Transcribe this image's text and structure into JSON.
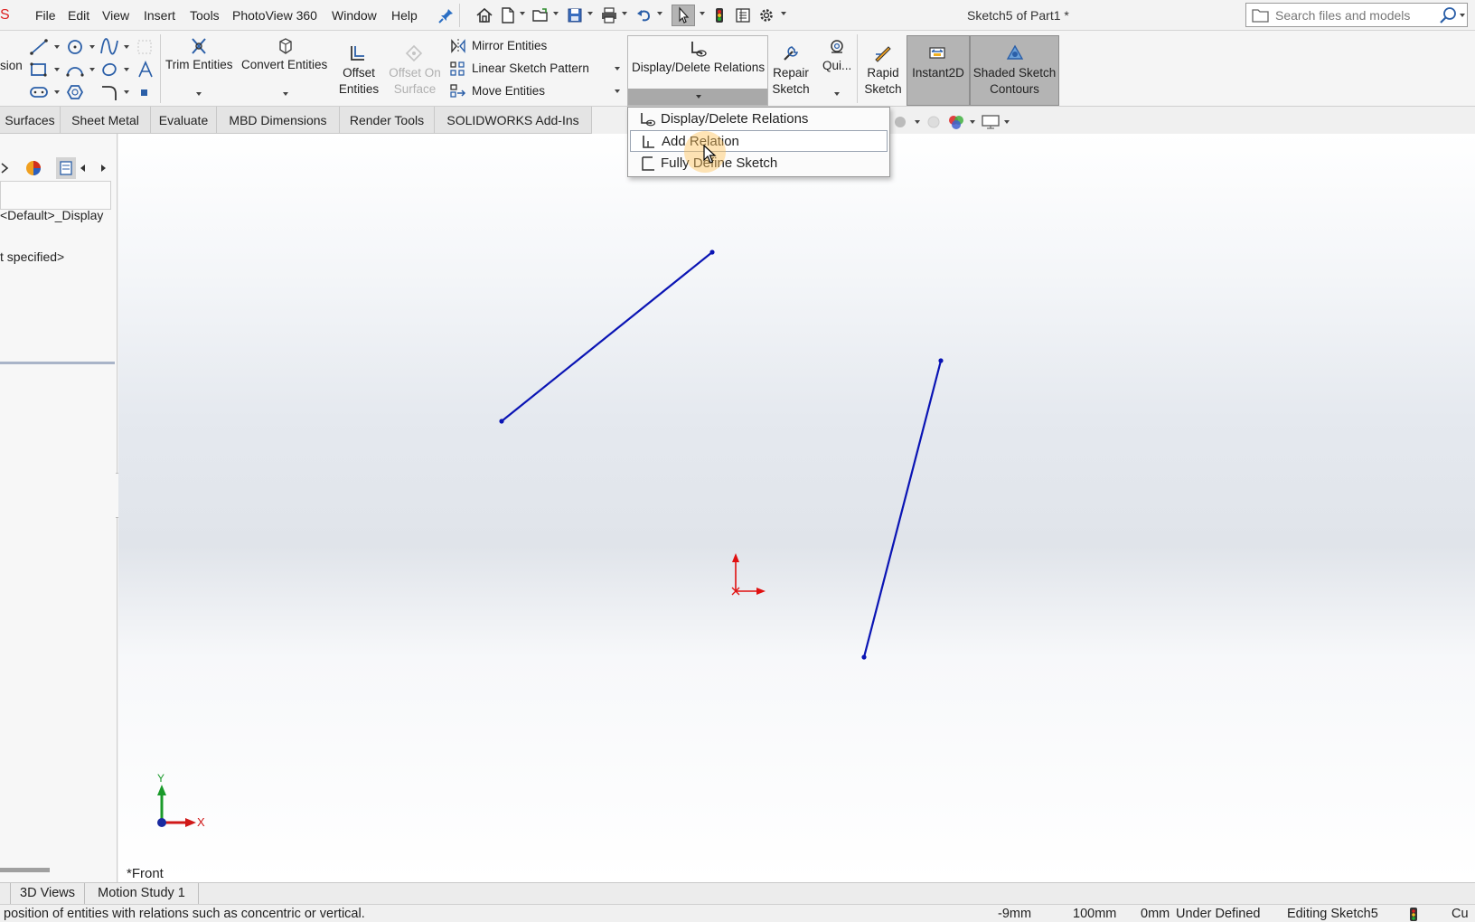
{
  "menubar": {
    "logo_fragment": "S",
    "items": [
      "File",
      "Edit",
      "View",
      "Insert",
      "Tools",
      "PhotoView 360",
      "Window",
      "Help"
    ],
    "document_title": "Sketch5 of Part1 *",
    "search_placeholder": "Search files and models"
  },
  "ribbon": {
    "smart_dimension_fragment": "sion",
    "trim_entities": "Trim Entities",
    "convert_entities": "Convert Entities",
    "offset_entities_l1": "Offset",
    "offset_entities_l2": "Entities",
    "offset_on_surface_l1": "Offset On",
    "offset_on_surface_l2": "Surface",
    "mirror_entities": "Mirror Entities",
    "linear_sketch_pattern": "Linear Sketch Pattern",
    "move_entities": "Move Entities",
    "display_delete_relations": "Display/Delete Relations",
    "repair_sketch_l1": "Repair",
    "repair_sketch_l2": "Sketch",
    "quick_snaps": "Qui...",
    "rapid_sketch_l1": "Rapid",
    "rapid_sketch_l2": "Sketch",
    "instant2d": "Instant2D",
    "shaded_sketch_contours_l1": "Shaded Sketch",
    "shaded_sketch_contours_l2": "Contours"
  },
  "tabs": [
    "Surfaces",
    "Sheet Metal",
    "Evaluate",
    "MBD Dimensions",
    "Render Tools",
    "SOLIDWORKS Add-Ins"
  ],
  "dropdown": {
    "items": [
      "Display/Delete Relations",
      "Add Relation",
      "Fully Define Sketch"
    ]
  },
  "left_panel": {
    "display_state": "<Default>_Display",
    "material": "t specified>"
  },
  "viewport": {
    "view_name": "*Front",
    "triad_y": "Y",
    "triad_x": "X"
  },
  "bottom_tabs": [
    "3D Views",
    "Motion Study 1"
  ],
  "status": {
    "message": "position of entities with relations such as concentric or vertical.",
    "x": "-9mm",
    "y": "100mm",
    "z": "0mm",
    "state": "Under Defined",
    "editing": "Editing Sketch5",
    "units_fragment": "Cu"
  },
  "colors": {
    "sketch_line": "#0a14b4",
    "origin": "#e01010",
    "triad_y": "#1a9a2a",
    "triad_x": "#d01818",
    "triad_center": "#1a2aa0"
  }
}
